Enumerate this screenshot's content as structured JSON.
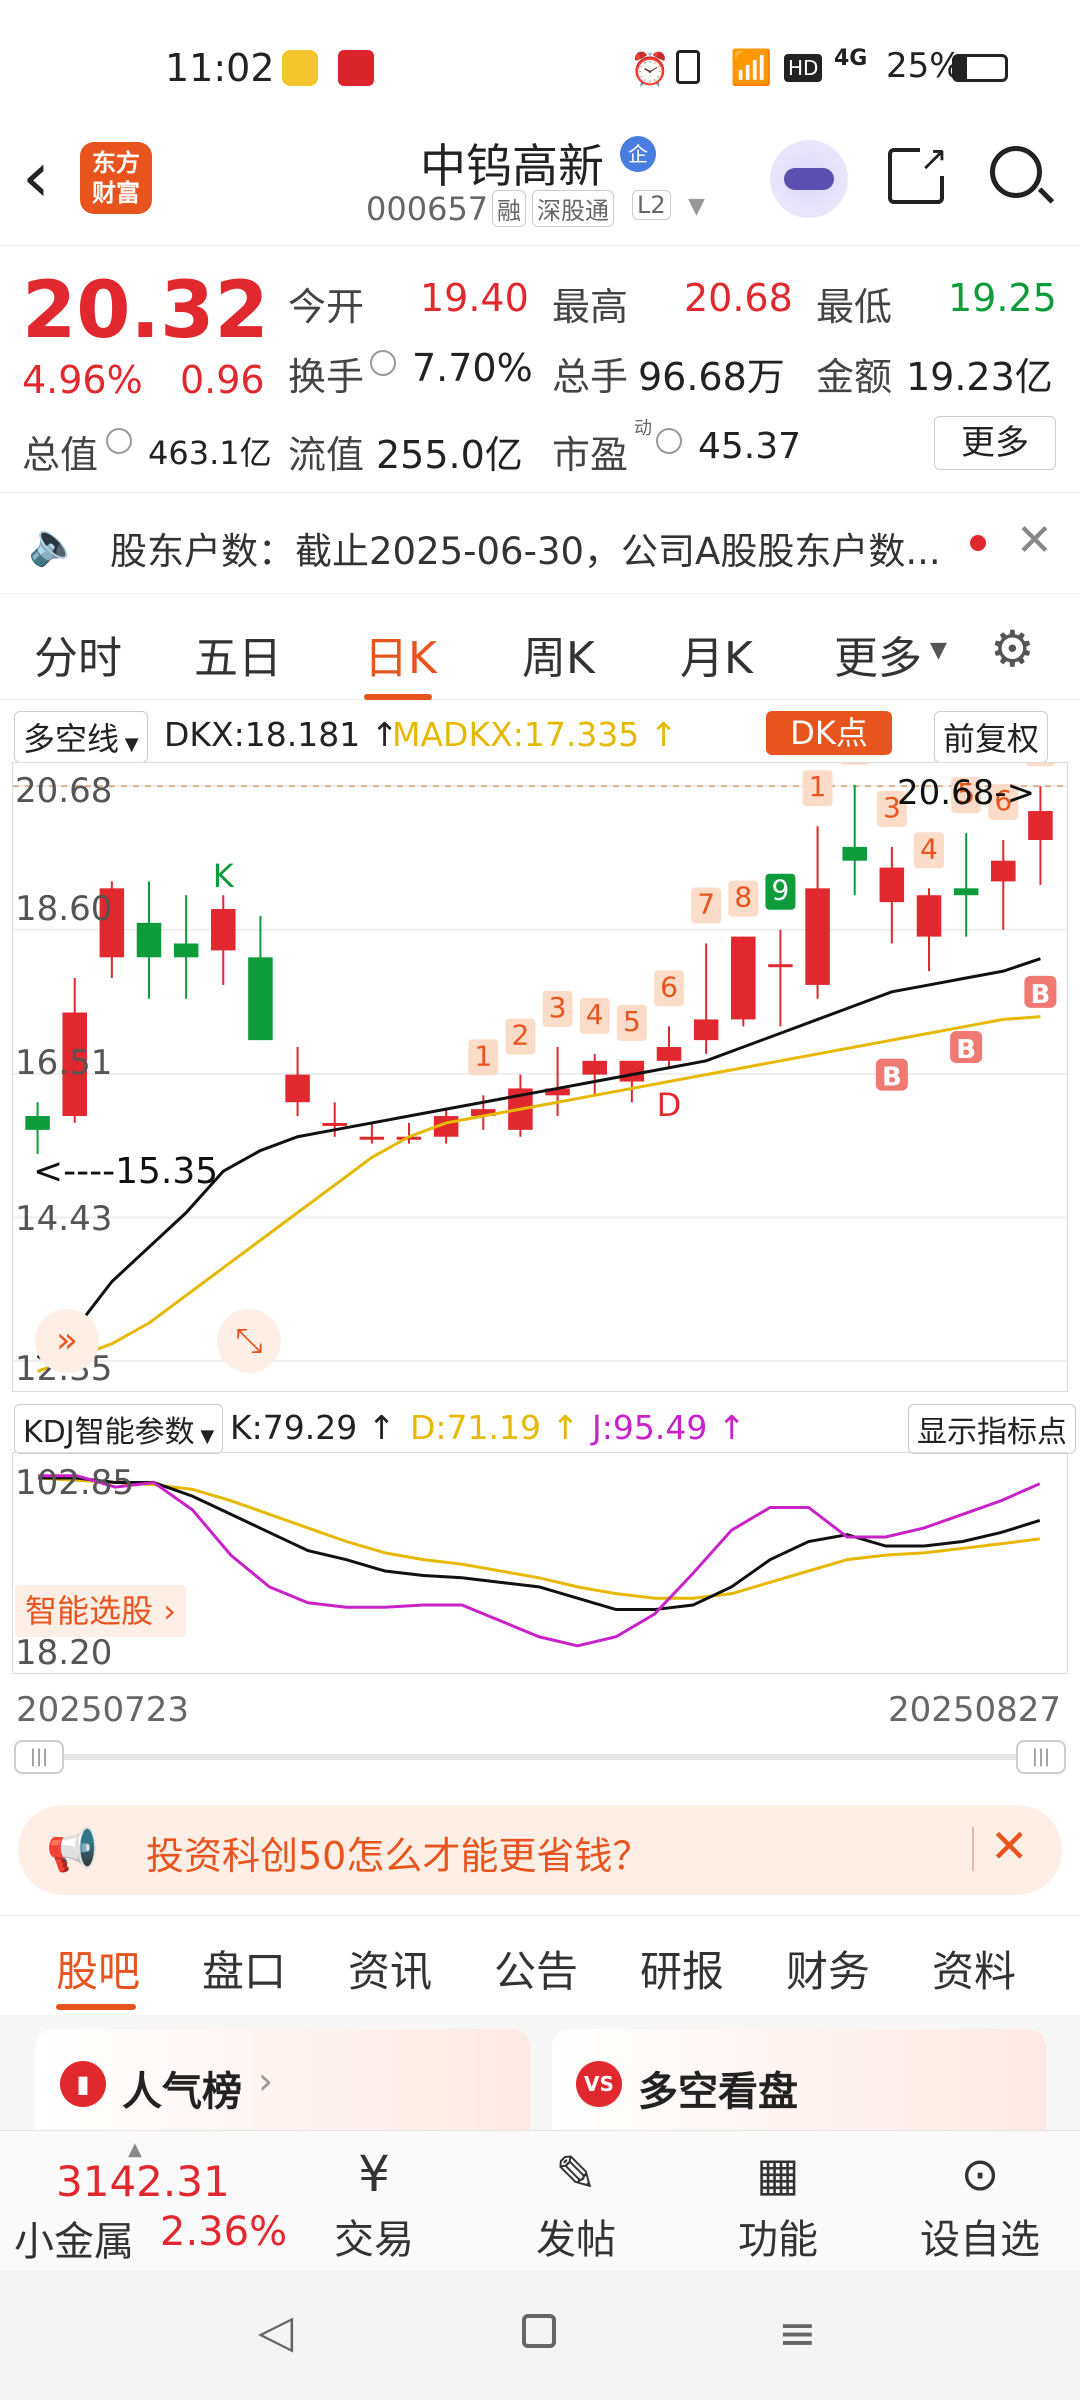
{
  "status": {
    "time": "11:02",
    "network": "4G",
    "battery": "25%"
  },
  "header": {
    "logo_line1": "东方",
    "logo_line2": "财富",
    "title": "中钨高新",
    "title_badge": "企",
    "code": "000657",
    "tag_rong": "融",
    "tag_connect": "深股通",
    "tag_level": "L2"
  },
  "quote": {
    "price": "20.32",
    "change_pct": "4.96%",
    "change_amt": "0.96",
    "open_label": "今开",
    "open": "19.40",
    "high_label": "最高",
    "high": "20.68",
    "low_label": "最低",
    "low": "19.25",
    "turnover_label": "换手",
    "turnover": "7.70%",
    "volume_label": "总手",
    "volume": "96.68万",
    "amount_label": "金额",
    "amount": "19.23亿",
    "mktcap_label": "总值",
    "mktcap": "463.1亿",
    "float_label": "流值",
    "float_val": "255.0亿",
    "pe_label": "市盈",
    "pe_sup": "动",
    "pe": "45.37",
    "more_label": "更多"
  },
  "notice": {
    "text": "股东户数：截止2025-06-30，公司A股股东户数..."
  },
  "chart_tabs": [
    "分时",
    "五日",
    "日K",
    "周K",
    "月K",
    "更多"
  ],
  "chart_tab_active": 2,
  "indicator": {
    "select": "多空线",
    "dkx": "DKX:18.181 ↑",
    "madkx": "MADKX:17.335 ↑",
    "dk_button": "DK点",
    "adjust_button": "前复权"
  },
  "chart_data": {
    "type": "candlestick",
    "ylim": [
      12.35,
      20.9
    ],
    "y_ticks": [
      "20.68",
      "18.60",
      "16.51",
      "14.43",
      "12.35"
    ],
    "max_label": "20.68->",
    "min_label": "<----15.35",
    "ohlc": [
      [
        15.9,
        16.1,
        15.35,
        15.7
      ],
      [
        15.9,
        17.9,
        15.8,
        17.4
      ],
      [
        18.2,
        19.3,
        17.9,
        19.2
      ],
      [
        18.7,
        19.3,
        17.6,
        18.2
      ],
      [
        18.4,
        19.1,
        17.6,
        18.2
      ],
      [
        18.3,
        19.1,
        17.8,
        18.9
      ],
      [
        18.2,
        18.8,
        17.0,
        17.0
      ],
      [
        16.1,
        16.9,
        15.9,
        16.5
      ],
      [
        15.8,
        16.1,
        15.6,
        15.8
      ],
      [
        15.6,
        15.8,
        15.5,
        15.6
      ],
      [
        15.6,
        15.8,
        15.5,
        15.6
      ],
      [
        15.6,
        16.0,
        15.5,
        15.9
      ],
      [
        15.9,
        16.2,
        15.7,
        16.0
      ],
      [
        15.7,
        16.5,
        15.6,
        16.3
      ],
      [
        16.2,
        16.9,
        15.9,
        16.3
      ],
      [
        16.5,
        16.8,
        16.2,
        16.7
      ],
      [
        16.4,
        16.7,
        16.1,
        16.7
      ],
      [
        16.7,
        17.2,
        16.6,
        16.9
      ],
      [
        17.0,
        18.4,
        16.8,
        17.3
      ],
      [
        17.3,
        18.5,
        17.2,
        18.5
      ],
      [
        18.1,
        18.6,
        17.2,
        18.1
      ],
      [
        17.8,
        20.1,
        17.6,
        19.2
      ],
      [
        19.8,
        20.7,
        19.1,
        19.6
      ],
      [
        19.0,
        19.8,
        18.4,
        19.5
      ],
      [
        18.5,
        19.2,
        18.0,
        19.1
      ],
      [
        19.2,
        20.0,
        18.5,
        19.1
      ],
      [
        19.3,
        19.9,
        18.6,
        19.6
      ],
      [
        19.9,
        20.68,
        19.25,
        20.32
      ]
    ],
    "dkx": [
      12.4,
      12.8,
      13.5,
      14.0,
      14.5,
      15.1,
      15.4,
      15.6,
      15.7,
      15.8,
      15.9,
      16.0,
      16.1,
      16.2,
      16.3,
      16.4,
      16.5,
      16.6,
      16.7,
      16.9,
      17.1,
      17.3,
      17.5,
      17.7,
      17.8,
      17.9,
      18.0,
      18.18
    ],
    "madkx": [
      12.2,
      12.4,
      12.6,
      12.9,
      13.3,
      13.7,
      14.1,
      14.5,
      14.9,
      15.3,
      15.6,
      15.8,
      15.9,
      16.0,
      16.1,
      16.2,
      16.3,
      16.4,
      16.5,
      16.6,
      16.7,
      16.8,
      16.9,
      17.0,
      17.1,
      17.2,
      17.3,
      17.34
    ],
    "signals": [
      {
        "i": 5,
        "text": "K"
      },
      {
        "i": 12,
        "text": "1"
      },
      {
        "i": 13,
        "text": "2"
      },
      {
        "i": 14,
        "text": "3"
      },
      {
        "i": 15,
        "text": "4"
      },
      {
        "i": 16,
        "text": "5"
      },
      {
        "i": 17,
        "text": "6"
      },
      {
        "i": 18,
        "text": "7"
      },
      {
        "i": 19,
        "text": "8"
      },
      {
        "i": 20,
        "text": "9"
      },
      {
        "i": 21,
        "text": "1"
      },
      {
        "i": 22,
        "text": "2"
      },
      {
        "i": 23,
        "text": "3"
      },
      {
        "i": 24,
        "text": "4"
      },
      {
        "i": 25,
        "text": "5"
      },
      {
        "i": 26,
        "text": "6"
      },
      {
        "i": 27,
        "text": "7"
      }
    ],
    "d_label": "D",
    "b_label": "B"
  },
  "kdj": {
    "select": "KDJ智能参数",
    "k": "K:79.29 ↑",
    "d": "D:71.19 ↑",
    "j": "J:95.49 ↑",
    "button": "显示指标点",
    "y_top": "102.85",
    "y_bottom": "18.20",
    "smart_pick": "智能选股",
    "ylim": [
      18.2,
      102.85
    ],
    "k_values": [
      98,
      98,
      96,
      96,
      90,
      82,
      74,
      66,
      62,
      57,
      55,
      54,
      52,
      50,
      45,
      40,
      40,
      42,
      50,
      62,
      70,
      73,
      68,
      68,
      70,
      74,
      79.29
    ],
    "d_values": [
      98,
      97,
      96,
      95,
      93,
      88,
      82,
      76,
      70,
      65,
      62,
      60,
      57,
      54,
      50,
      47,
      45,
      45,
      47,
      52,
      57,
      62,
      64,
      65,
      67,
      69,
      71.19
    ],
    "j_values": [
      99,
      99,
      94,
      96,
      84,
      64,
      50,
      43,
      41,
      41,
      42,
      42,
      35,
      28,
      24,
      28,
      38,
      56,
      75,
      85,
      85,
      72,
      72,
      76,
      82,
      88,
      95.49
    ]
  },
  "date_start": "20250723",
  "date_end": "20250827",
  "banner": {
    "text": "投资科创50怎么才能更省钱？"
  },
  "bottom_tabs": [
    "股吧",
    "盘口",
    "资讯",
    "公告",
    "研报",
    "财务",
    "资料"
  ],
  "cards": {
    "hot": "人气榜",
    "vs": "多空看盘"
  },
  "toolbar": {
    "index_value": "3142.31",
    "index_name": "小金属",
    "index_change": "2.36%",
    "trade": "交易",
    "post": "发帖",
    "func": "功能",
    "watch": "设自选"
  },
  "colors": {
    "up": "#e0282e",
    "down": "#0e9b3a",
    "accent": "#e8541e",
    "dkx": "#111111",
    "madkx": "#e6b800",
    "j": "#c822c8"
  }
}
